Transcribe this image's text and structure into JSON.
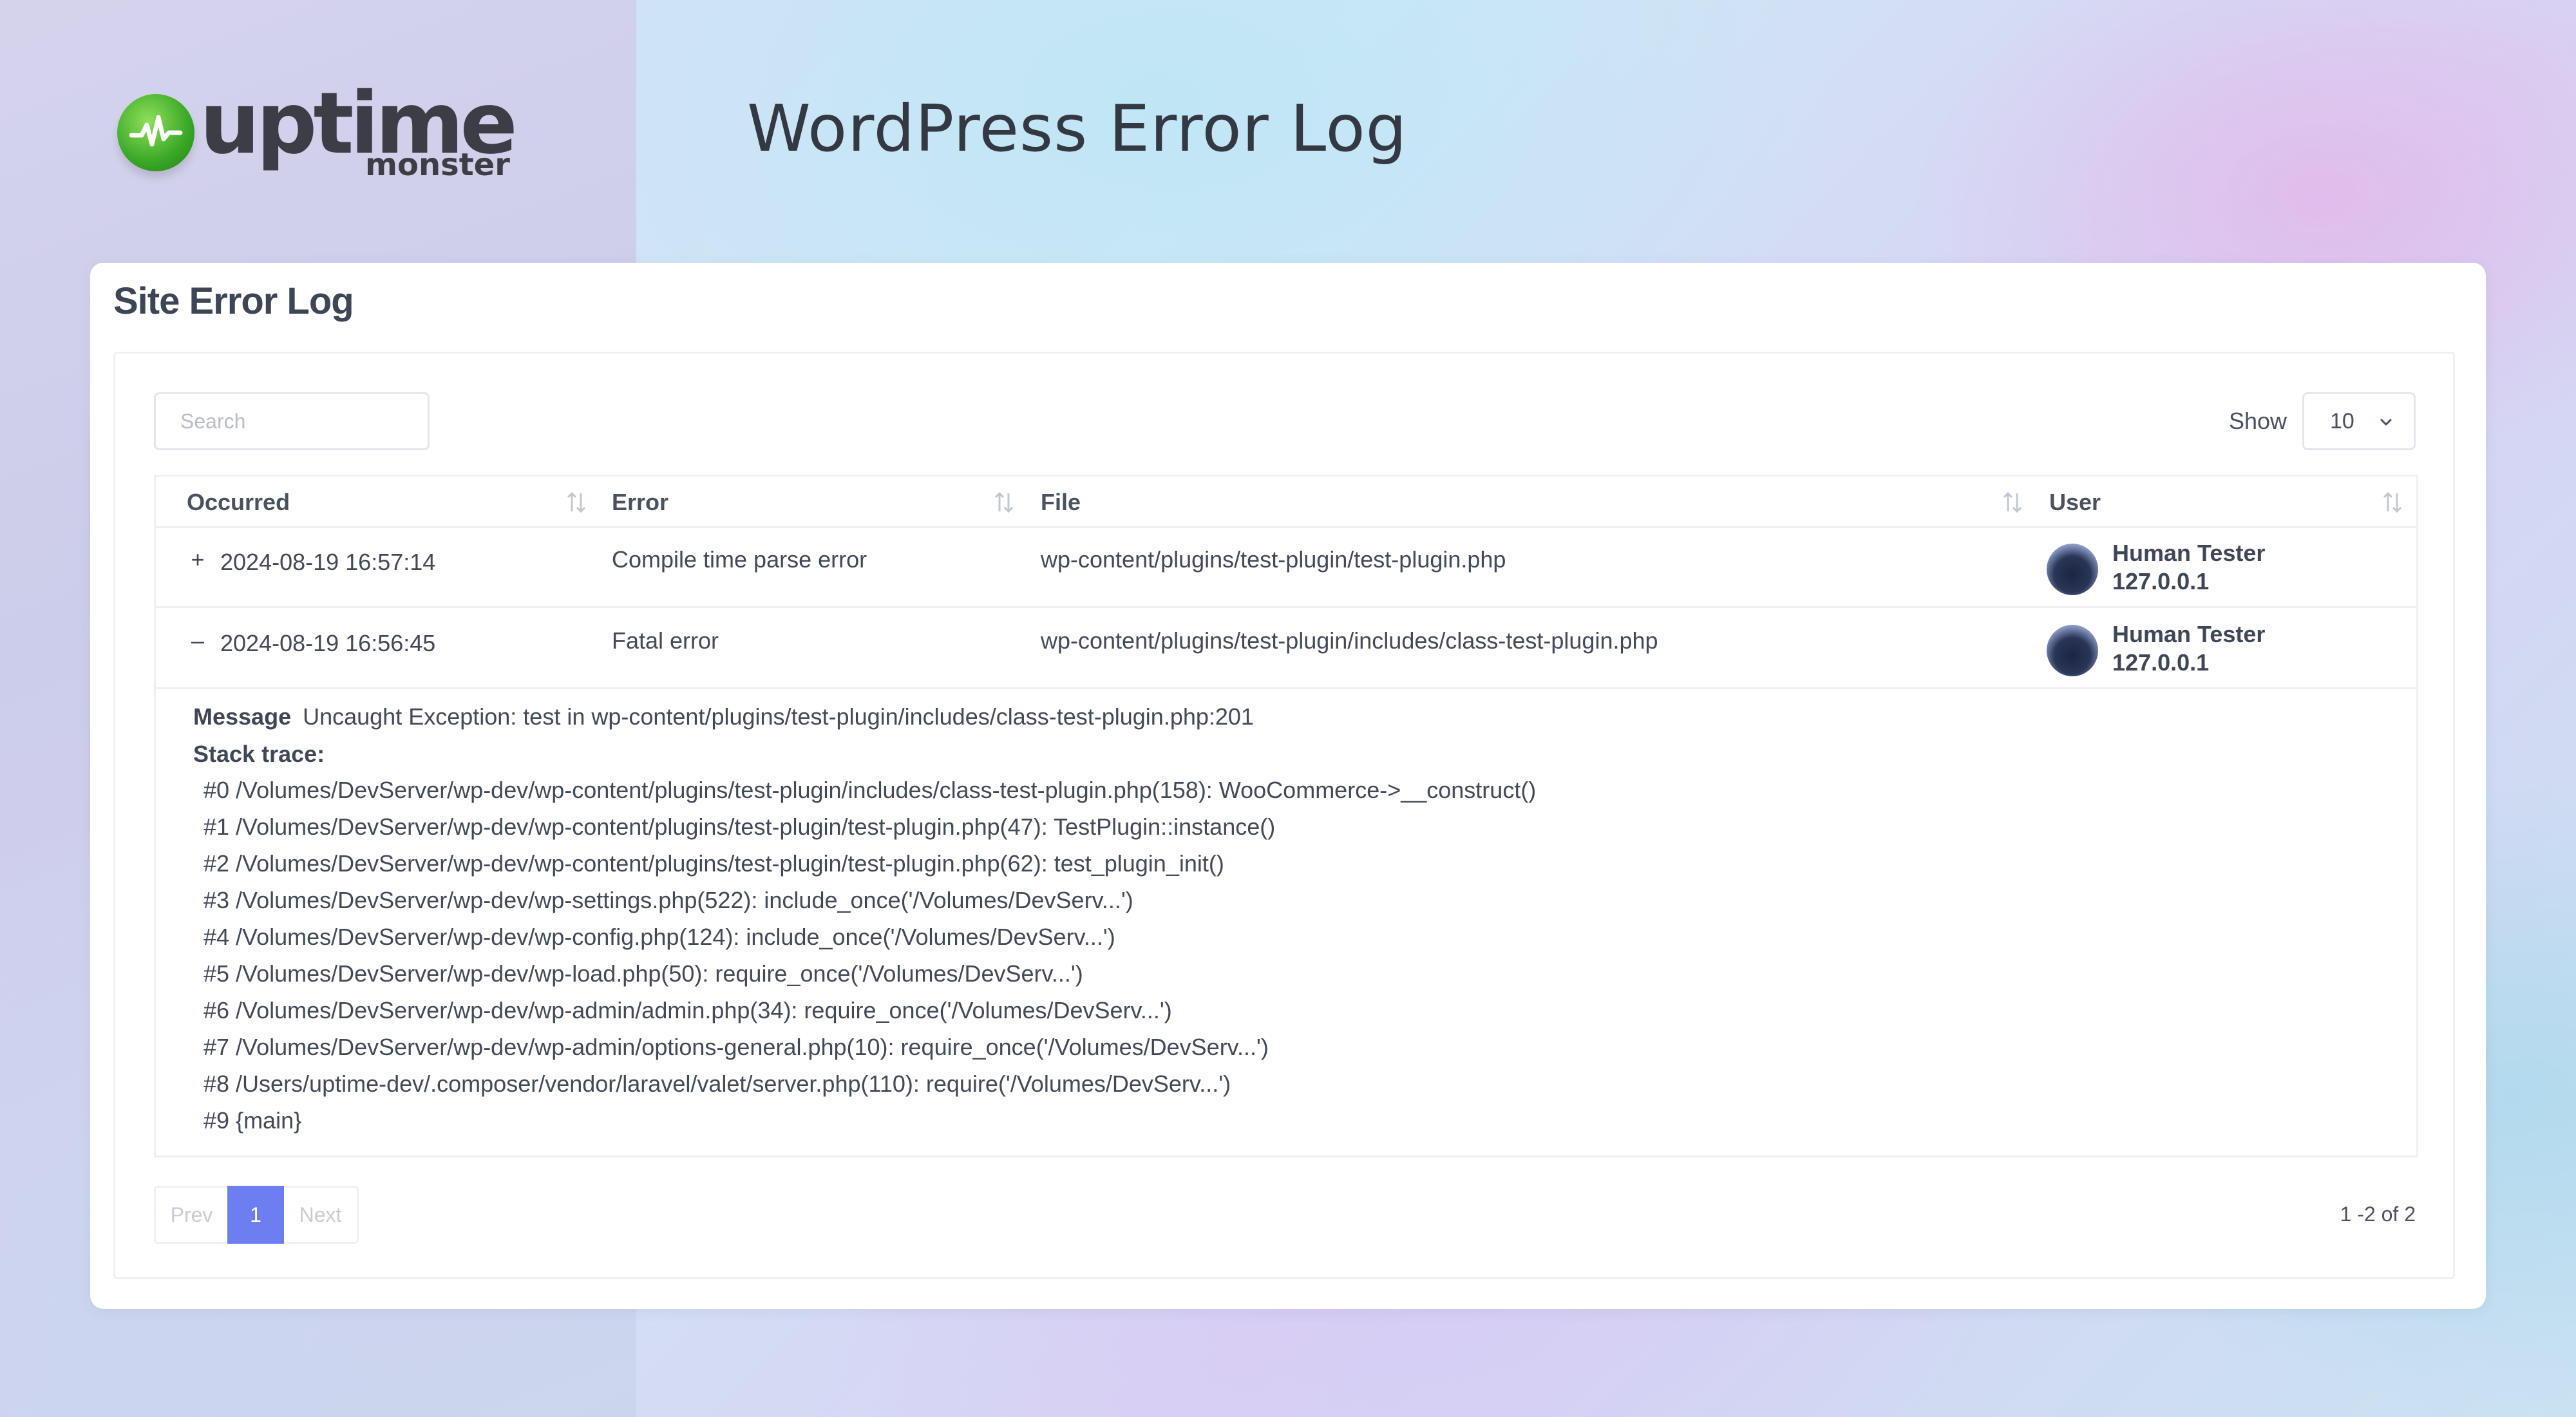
{
  "header": {
    "logo_word": "uptime",
    "logo_sub": "monster",
    "page_title": "WordPress Error Log"
  },
  "card": {
    "title": "Site Error Log"
  },
  "controls": {
    "search_placeholder": "Search",
    "show_label": "Show",
    "show_value": "10"
  },
  "table": {
    "columns": [
      "Occurred",
      "Error",
      "File",
      "User"
    ],
    "rows": [
      {
        "toggle": "+",
        "occurred": "2024-08-19 16:57:14",
        "error": "Compile time parse error",
        "file": "wp-content/plugins/test-plugin/test-plugin.php",
        "user_name": "Human Tester",
        "user_ip": "127.0.0.1"
      },
      {
        "toggle": "–",
        "occurred": "2024-08-19 16:56:45",
        "error": "Fatal error",
        "file": "wp-content/plugins/test-plugin/includes/class-test-plugin.php",
        "user_name": "Human Tester",
        "user_ip": "127.0.0.1"
      }
    ],
    "details": {
      "message_label": "Message",
      "message": "Uncaught Exception: test in wp-content/plugins/test-plugin/includes/class-test-plugin.php:201",
      "stack_label": "Stack trace:",
      "trace": [
        "#0 /Volumes/DevServer/wp-dev/wp-content/plugins/test-plugin/includes/class-test-plugin.php(158): WooCommerce->__construct()",
        "#1 /Volumes/DevServer/wp-dev/wp-content/plugins/test-plugin/test-plugin.php(47): TestPlugin::instance()",
        "#2 /Volumes/DevServer/wp-dev/wp-content/plugins/test-plugin/test-plugin.php(62): test_plugin_init()",
        "#3 /Volumes/DevServer/wp-dev/wp-settings.php(522): include_once('/Volumes/DevServ...')",
        "#4 /Volumes/DevServer/wp-dev/wp-config.php(124): include_once('/Volumes/DevServ...')",
        "#5 /Volumes/DevServer/wp-dev/wp-load.php(50): require_once('/Volumes/DevServ...')",
        "#6 /Volumes/DevServer/wp-dev/wp-admin/admin.php(34): require_once('/Volumes/DevServ...')",
        "#7 /Volumes/DevServer/wp-dev/wp-admin/options-general.php(10): require_once('/Volumes/DevServ...')",
        "#8 /Users/uptime-dev/.composer/vendor/laravel/valet/server.php(110): require('/Volumes/DevServ...')",
        "#9 {main}"
      ]
    }
  },
  "pagination": {
    "prev": "Prev",
    "current": "1",
    "next": "Next",
    "count": "1 -2 of 2"
  },
  "colors": {
    "accent": "#6c7ef0",
    "logo_green": "#3aa726"
  }
}
